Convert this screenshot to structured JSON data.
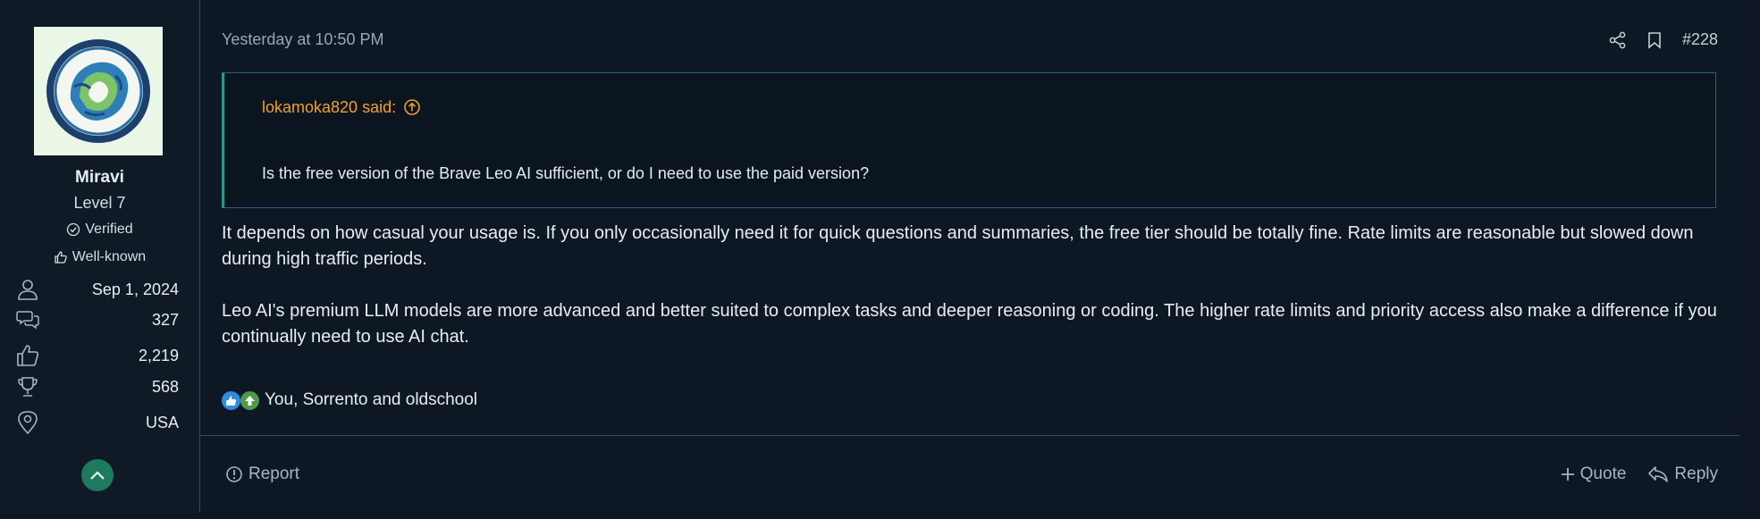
{
  "user": {
    "name": "Miravi",
    "level": "Level 7",
    "badges": [
      "Verified",
      "Well-known"
    ],
    "stats": [
      {
        "icon": "user-icon",
        "value": "Sep 1, 2024"
      },
      {
        "icon": "messages-icon",
        "value": "327"
      },
      {
        "icon": "thumbs-up-icon",
        "value": "2,219"
      },
      {
        "icon": "trophy-icon",
        "value": "568"
      },
      {
        "icon": "location-icon",
        "value": "USA"
      }
    ]
  },
  "post": {
    "timestamp": "Yesterday at 10:50 PM",
    "number": "#228",
    "quote": {
      "author": "lokamoka820 said:",
      "text": "Is the free version of the Brave Leo AI sufficient, or do I need to use the paid version?"
    },
    "paragraphs": [
      "It depends on how casual your usage is. If you only occasionally need it for quick questions and summaries, the free tier should be totally fine. Rate limits are reasonable but slowed down during high traffic periods.",
      "Leo AI's premium LLM models are more advanced and better suited to complex tasks and deeper reasoning or coding. The higher rate limits and priority access also make a difference if you continually need to use AI chat."
    ],
    "reactions_text": "You, Sorrento and oldschool"
  },
  "footer": {
    "report": "Report",
    "quote": "Quote",
    "reply": "Reply"
  },
  "colors": {
    "accent_quote_author": "#f0a12a",
    "quote_border": "#2a9a86",
    "scroll_button": "#1d7a5f"
  }
}
